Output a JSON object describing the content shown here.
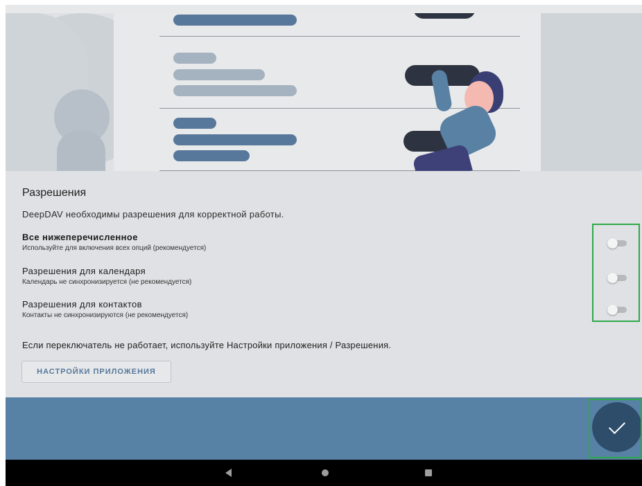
{
  "permissions": {
    "title": "Разрешения",
    "description": "DeepDAV необходимы разрешения для корректной работы.",
    "items": [
      {
        "label": "Все нижеперечисленное",
        "sublabel": "Используйте для включения всех опций (рекомендуется)",
        "enabled": false
      },
      {
        "label": "Разрешения для календаря",
        "sublabel": "Календарь не синхронизируется (не рекомендуется)",
        "enabled": false
      },
      {
        "label": "Разрешения для контактов",
        "sublabel": "Контакты не синхронизируются (не рекомендуется)",
        "enabled": false
      }
    ],
    "hint": "Если переключатель не работает, используйте Настройки приложения / Разрешения.",
    "settings_button_label": "НАСТРОЙКИ ПРИЛОЖЕНИЯ"
  },
  "fab": {
    "icon": "check-icon"
  },
  "nav": {
    "back_icon": "back-triangle-icon",
    "home_icon": "home-circle-icon",
    "recents_icon": "recents-square-icon"
  },
  "colors": {
    "accent": "#5882a5",
    "fab": "#2e4d6b",
    "button_text": "#56789b",
    "highlight": "#2ea84a",
    "background": "#dfe1e4"
  }
}
